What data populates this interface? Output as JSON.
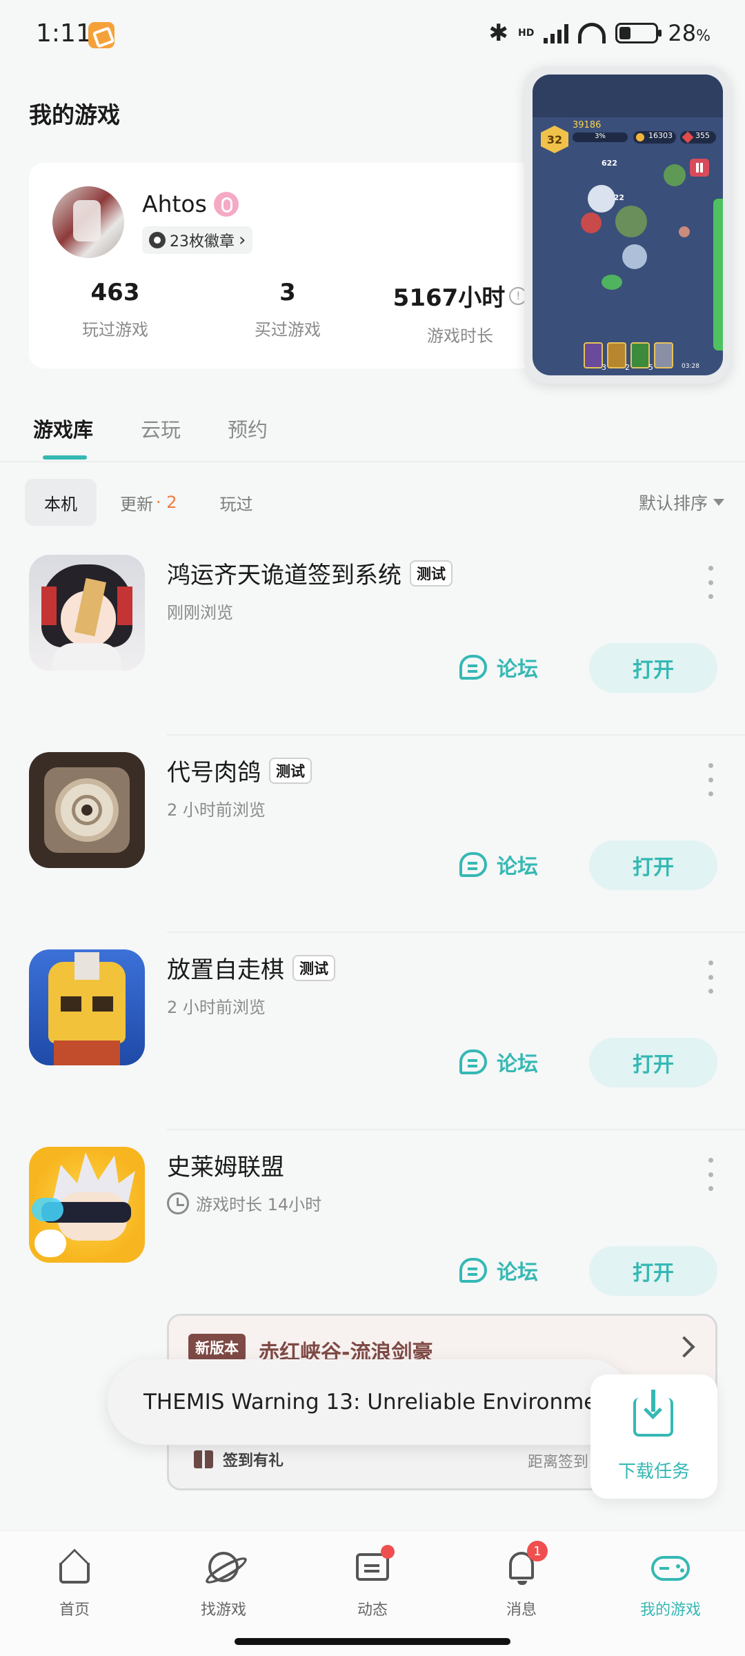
{
  "status_bar": {
    "time": "1:11",
    "network": "HD",
    "battery": "28",
    "battery_symbol": "%"
  },
  "page_title": "我的游戏",
  "profile": {
    "username": "Ahtos",
    "badges": "23枚徽章",
    "stats": [
      {
        "value": "463",
        "label": "玩过游戏"
      },
      {
        "value": "3",
        "label": "买过游戏"
      },
      {
        "value": "5167小时",
        "label": "游戏时长"
      }
    ]
  },
  "game_preview": {
    "level": "32",
    "gold_top": "39186",
    "progress": "3%",
    "coins": "16303",
    "gems": "355",
    "damage_1": "622",
    "damage_2": "622",
    "card_counts": [
      "3",
      "2",
      "5"
    ],
    "timer": "03:28"
  },
  "main_tabs": [
    "游戏库",
    "云玩",
    "预约"
  ],
  "sub_tabs": {
    "local": "本机",
    "update": "更新",
    "update_count": "· 2",
    "played": "玩过"
  },
  "sort_label": "默认排序",
  "games": [
    {
      "title": "鸿运齐天诡道签到系统",
      "tag": "测试",
      "subtitle": "刚刚浏览",
      "forum": "论坛",
      "open": "打开"
    },
    {
      "title": "代号肉鸽",
      "tag": "测试",
      "subtitle": "2 小时前浏览",
      "forum": "论坛",
      "open": "打开"
    },
    {
      "title": "放置自走棋",
      "tag": "测试",
      "subtitle": "2 小时前浏览",
      "forum": "论坛",
      "open": "打开"
    },
    {
      "title": "史莱姆联盟",
      "tag": "",
      "subtitle": "游戏时长 14小时",
      "forum": "论坛",
      "open": "打开"
    }
  ],
  "version_banner": {
    "tag": "新版本",
    "title": "赤红峡谷-流浪剑豪",
    "gift": "签到有礼",
    "countdown": "距离签到"
  },
  "toast": "THEMIS Warning 13: Unreliable Environment",
  "download_task": "下载任务",
  "bottom_nav": [
    {
      "label": "首页"
    },
    {
      "label": "找游戏"
    },
    {
      "label": "动态"
    },
    {
      "label": "消息",
      "badge": "1"
    },
    {
      "label": "我的游戏"
    }
  ],
  "colors": {
    "accent": "#35b8b4",
    "badge": "#ef4f4f",
    "update_count": "#f07a3a",
    "version": "#7e4a45"
  }
}
